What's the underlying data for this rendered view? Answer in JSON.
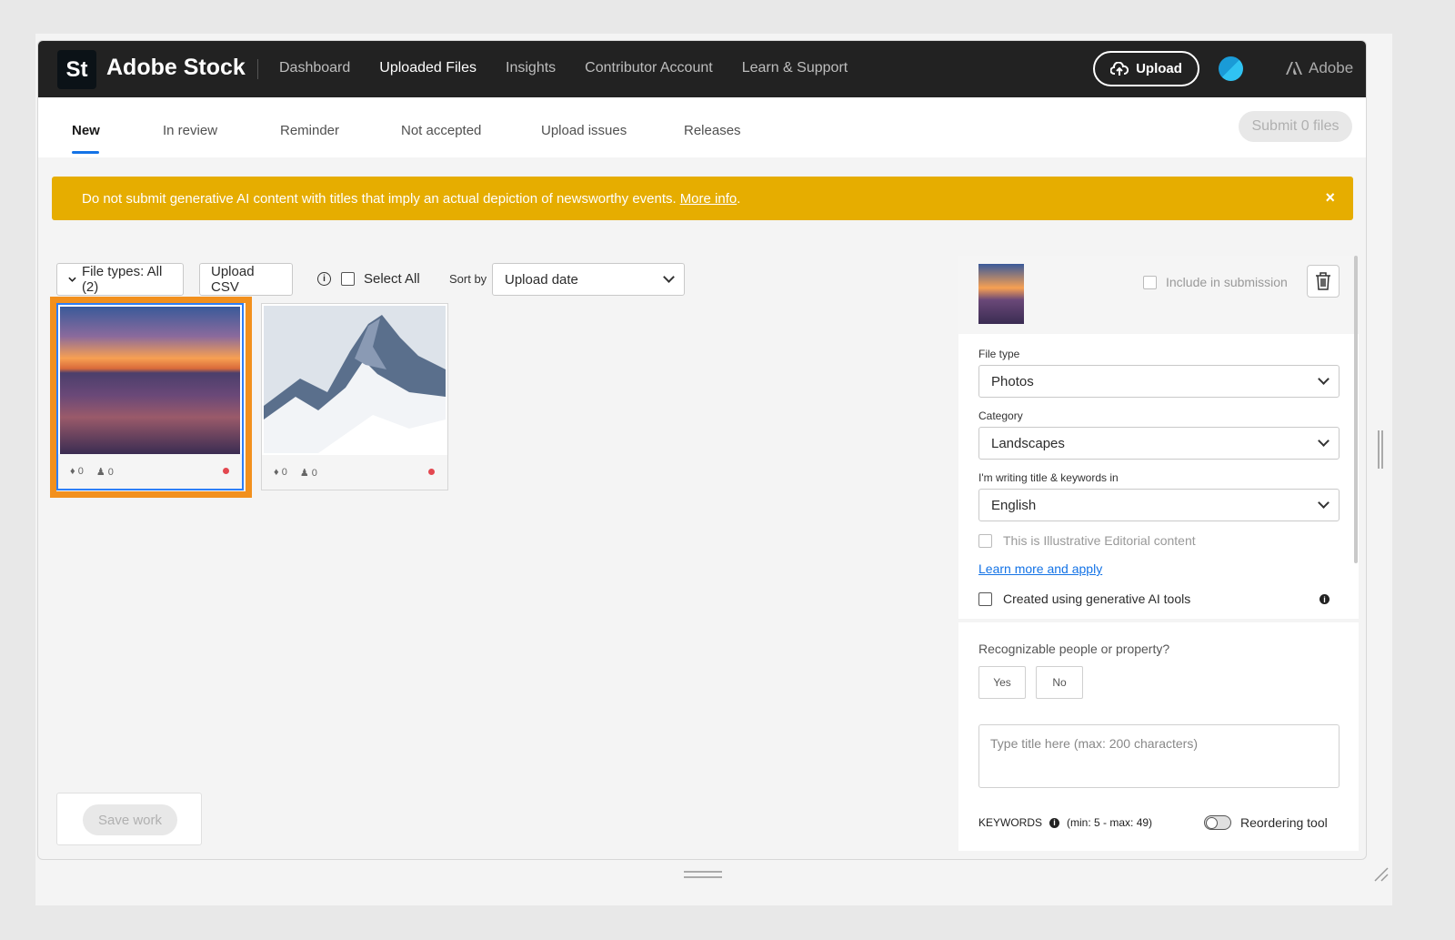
{
  "app": {
    "logo_text": "St",
    "brand": "Adobe Stock",
    "nav": [
      "Dashboard",
      "Uploaded Files",
      "Insights",
      "Contributor Account",
      "Learn & Support"
    ],
    "upload_label": "Upload",
    "adobe_label": "Adobe"
  },
  "tabs": [
    "New",
    "In review",
    "Reminder",
    "Not accepted",
    "Upload issues",
    "Releases"
  ],
  "submit_label": "Submit 0 files",
  "banner": {
    "text": "Do not submit generative AI content with titles that imply an actual depiction of newsworthy events.",
    "link": "More info",
    "link_suffix": ".",
    "close": "×"
  },
  "toolbar": {
    "file_types": "File types: All (2)",
    "upload_csv": "Upload CSV",
    "info_glyph": "i",
    "select_all": "Select All",
    "sort_by": "Sort by",
    "sort_value": "Upload date"
  },
  "thumbnails": [
    {
      "keywords": "0",
      "releases": "0",
      "selected": true
    },
    {
      "keywords": "0",
      "releases": "0",
      "selected": false
    }
  ],
  "save_work": "Save work",
  "panel": {
    "include_label": "Include in submission",
    "file_type_label": "File type",
    "file_type_value": "Photos",
    "category_label": "Category",
    "category_value": "Landscapes",
    "language_label": "I'm writing title & keywords in",
    "language_value": "English",
    "illustrative_label": "This is Illustrative Editorial content",
    "learn_more": "Learn more and apply",
    "gen_ai_label": "Created using generative AI tools",
    "info_glyph": "i",
    "recognizable_q": "Recognizable people or property?",
    "yes": "Yes",
    "no": "No",
    "title_placeholder": "Type title here (max: 200 characters)",
    "keywords_label": "KEYWORDS",
    "keywords_range": "(min: 5 - max: 49)",
    "reordering_label": "Reordering tool"
  },
  "colors": {
    "banner": "#e6ad00",
    "accent": "#1473e6",
    "selection": "#f2901d",
    "topnav": "#222222"
  }
}
